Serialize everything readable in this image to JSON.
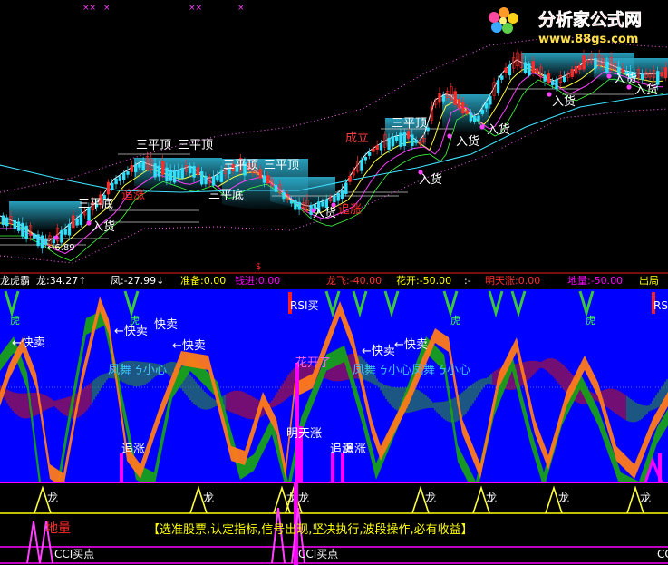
{
  "logo": {
    "brand": "分析家公式网",
    "url": "www.88gs.com"
  },
  "price_panel": {
    "markers": [
      "××",
      "×",
      "××",
      "×"
    ],
    "low_value": "←6.89",
    "labels": [
      {
        "text": "三平顶",
        "kind": "pattern"
      },
      {
        "text": "三平顶",
        "kind": "pattern"
      },
      {
        "text": "三平顶",
        "kind": "pattern"
      },
      {
        "text": "三平顶",
        "kind": "pattern"
      },
      {
        "text": "三平顶",
        "kind": "pattern"
      },
      {
        "text": "三平底",
        "kind": "pattern"
      },
      {
        "text": "三平底",
        "kind": "pattern"
      },
      {
        "text": "成立",
        "kind": "pattern"
      },
      {
        "text": "追涨",
        "kind": "signal"
      },
      {
        "text": "追涨",
        "kind": "signal"
      },
      {
        "text": "入货",
        "kind": "buy"
      },
      {
        "text": "入货",
        "kind": "buy"
      },
      {
        "text": "入货",
        "kind": "buy"
      },
      {
        "text": "入货",
        "kind": "buy"
      },
      {
        "text": "入货",
        "kind": "buy"
      },
      {
        "text": "入货",
        "kind": "buy"
      },
      {
        "text": "入货",
        "kind": "buy"
      },
      {
        "text": "入货",
        "kind": "buy"
      }
    ]
  },
  "indicator_header": {
    "name": "龙虎霸",
    "items": [
      {
        "text": "龙:34.27",
        "arrow": "↑",
        "color": "#ffffff"
      },
      {
        "text": "凤:-27.99",
        "arrow": "↓",
        "color": "#ffffff"
      },
      {
        "text": "准备:0.00",
        "color": "#ffff00"
      },
      {
        "text": "钱进:0.00",
        "color": "#ff00ff"
      },
      {
        "text": "龙飞:-40.00",
        "color": "#ff3030"
      },
      {
        "text": "花开:-50.00",
        "color": "#ffff00"
      },
      {
        "text": ":-",
        "color": "#ffffff"
      },
      {
        "text": "明天涨:0.00",
        "color": "#ff3030"
      },
      {
        "text": "地量:-50.00",
        "color": "#ff00ff"
      },
      {
        "text": "出局",
        "color": "#ffff00"
      }
    ],
    "marker": "$"
  },
  "indicator_panel": {
    "labels": [
      {
        "text": "虎",
        "color": "#40ff40"
      },
      {
        "text": "虎",
        "color": "#40ff40"
      },
      {
        "text": "虎",
        "color": "#40ff40"
      },
      {
        "text": "虎",
        "color": "#40ff40"
      },
      {
        "text": "RSI买",
        "color": "#ffffff"
      },
      {
        "text": "RSI",
        "color": "#ffffff"
      },
      {
        "text": "←快卖",
        "color": "#ffffff"
      },
      {
        "text": "←快卖",
        "color": "#ffffff"
      },
      {
        "text": "快卖",
        "color": "#ffffff"
      },
      {
        "text": "←快卖",
        "color": "#ffffff"
      },
      {
        "text": "←快卖",
        "color": "#ffffff"
      },
      {
        "text": "←快卖",
        "color": "#ffffff"
      },
      {
        "text": "凤舞ㄋ小心",
        "color": "#40c0ff"
      },
      {
        "text": "凤舞ㄋ小心凤舞ㄋ小心",
        "color": "#40c0ff"
      },
      {
        "text": "花开了",
        "color": "#ff60ff"
      },
      {
        "text": "明天涨",
        "color": "#ffffff"
      },
      {
        "text": "追涨",
        "color": "#ffffff"
      },
      {
        "text": "追涨",
        "color": "#ffffff"
      },
      {
        "text": "追涨",
        "color": "#ffffff"
      }
    ]
  },
  "bottom_panel": {
    "dragon_label": "龙",
    "ground_volume": "地量",
    "slogan": "【选准股票,认定指标,信号出现,坚决执行,波段操作,必有收益】",
    "cci_label": "CCI买点",
    "cci_label_short": "CC"
  },
  "colors": {
    "background": "#000000",
    "indicator_bg": "#0000ff",
    "dragon": "#ff7a1a",
    "phoenix": "#18a018",
    "ribbon_red": "#c01818",
    "ribbon_green": "#2f8f2f",
    "signal_magenta": "#ff00ff",
    "yellow": "#ffff00"
  }
}
